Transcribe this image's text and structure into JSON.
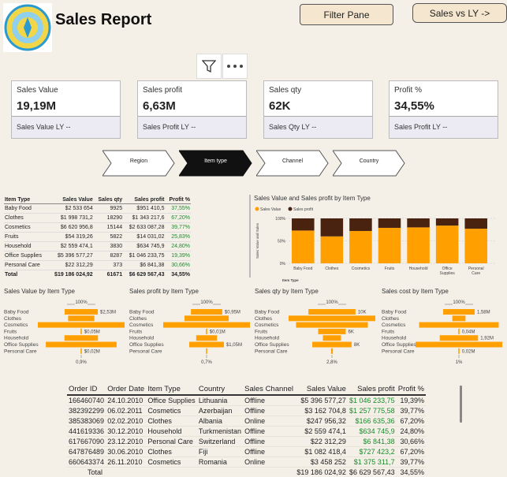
{
  "header": {
    "title": "Sales Report",
    "filter_pane_label": "Filter Pane",
    "sales_vs_ly_label": "Sales vs LY ->"
  },
  "kpis": [
    {
      "label": "Sales Value",
      "value": "19,19M",
      "ly": "Sales Value LY --"
    },
    {
      "label": "Sales profit",
      "value": "6,63M",
      "ly": "Sales Profit LY --"
    },
    {
      "label": "Sales qty",
      "value": "62K",
      "ly": "Sales Qty LY --"
    },
    {
      "label": "Profit %",
      "value": "34,55%",
      "ly": "Sales Profit LY --"
    }
  ],
  "nav": [
    "Region",
    "Item type",
    "Channel",
    "Country"
  ],
  "nav_active": 1,
  "item_table": {
    "headers": [
      "Item Type",
      "Sales Value",
      "Sales qty",
      "Sales profit",
      "Profit %"
    ],
    "rows": [
      [
        "Baby Food",
        "$2 533 654",
        "9925",
        "$951 410,5",
        "37,55%"
      ],
      [
        "Clothes",
        "$1 998 731,2",
        "18290",
        "$1 343 217,6",
        "67,20%"
      ],
      [
        "Cosmetics",
        "$6 620 956,8",
        "15144",
        "$2 633 087,28",
        "39,77%"
      ],
      [
        "Fruits",
        "$54 319,26",
        "5822",
        "$14 031,02",
        "25,83%"
      ],
      [
        "Household",
        "$2 559 474,1",
        "3830",
        "$634 745,9",
        "24,80%"
      ],
      [
        "Office Supplies",
        "$5 396 577,27",
        "8287",
        "$1 046 233,75",
        "19,39%"
      ],
      [
        "Personal Care",
        "$22 312,29",
        "373",
        "$6 841,38",
        "30,66%"
      ]
    ],
    "total": [
      "Total",
      "$19 186 024,92",
      "61671",
      "$6 629 567,43",
      "34,55%"
    ]
  },
  "stacked_chart": {
    "title": "Sales Value and Sales profit by Item Type",
    "legend": [
      "Sales Value",
      "Sales profit"
    ],
    "colors": [
      "#ff9f00",
      "#4a2210"
    ],
    "ylabel": "Sales Value and Sales",
    "xlabel": "Item Type",
    "yticks": [
      "100%",
      "50%",
      "0%"
    ]
  },
  "chart_data": [
    {
      "type": "bar",
      "title": "Sales Value and Sales profit by Item Type",
      "categories": [
        "Baby Food",
        "Clothes",
        "Cosmetics",
        "Fruits",
        "Household",
        "Office Supplies",
        "Personal Care"
      ],
      "series": [
        {
          "name": "Sales Value",
          "values": [
            73,
            60,
            72,
            79,
            80,
            84,
            77
          ]
        },
        {
          "name": "Sales profit",
          "values": [
            27,
            40,
            28,
            21,
            20,
            16,
            23
          ]
        }
      ],
      "xlabel": "Item Type",
      "ylabel": "Sales Value and Sales",
      "ylim": [
        0,
        100
      ]
    },
    {
      "type": "bar",
      "title": "Sales Value by Item Type",
      "categories": [
        "Baby Food",
        "Clothes",
        "Cosmetics",
        "Fruits",
        "Household",
        "Office Supplies",
        "Personal Care"
      ],
      "values": [
        2.53,
        2.0,
        6.62,
        0.05,
        2.56,
        5.4,
        0.02
      ],
      "top_label": "100%",
      "bottom_label": "0,9%",
      "bar_labels": [
        "$2,53M",
        "",
        "",
        "$0,05M",
        "",
        "",
        "$0,02M"
      ]
    },
    {
      "type": "bar",
      "title": "Sales profit by Item Type",
      "categories": [
        "Baby Food",
        "Clothes",
        "Cosmetics",
        "Fruits",
        "Household",
        "Office Supplies",
        "Personal Care"
      ],
      "values": [
        0.95,
        1.34,
        2.63,
        0.01,
        0.63,
        1.05,
        0.01
      ],
      "top_label": "100%",
      "bottom_label": "0,7%",
      "bar_labels": [
        "$0,95M",
        "",
        "",
        "$0,01M",
        "",
        "$1,05M",
        ""
      ]
    },
    {
      "type": "bar",
      "title": "Sales qty by Item Type",
      "categories": [
        "Baby Food",
        "Clothes",
        "Cosmetics",
        "Fruits",
        "Household",
        "Office Supplies",
        "Personal Care"
      ],
      "values": [
        9925,
        18290,
        15144,
        5822,
        3830,
        8287,
        373
      ],
      "top_label": "100%",
      "bottom_label": "2,8%",
      "bar_labels": [
        "10K",
        "",
        "",
        "6K",
        "",
        "8K",
        ""
      ]
    },
    {
      "type": "bar",
      "title": "Sales cost by Item Type",
      "categories": [
        "Baby Food",
        "Clothes",
        "Cosmetics",
        "Fruits",
        "Household",
        "Office Supplies",
        "Personal Care"
      ],
      "values": [
        1.58,
        0.66,
        3.99,
        0.04,
        1.92,
        4.35,
        0.02
      ],
      "top_label": "100%",
      "bottom_label": "1%",
      "bar_labels": [
        "1,58M",
        "",
        "",
        "0,04M",
        "1,92M",
        "",
        "0,02M"
      ]
    }
  ],
  "orders_table": {
    "headers": [
      "Order ID",
      "Order Date",
      "Item Type",
      "Country",
      "Sales Channel",
      "Sales Value",
      "Sales profit",
      "Profit %"
    ],
    "rows": [
      [
        "166460740",
        "24.10.2010",
        "Office Supplies",
        "Lithuania",
        "Offline",
        "$5 396 577,27",
        "$1 046 233,75",
        "19,39%"
      ],
      [
        "382392299",
        "06.02.2011",
        "Cosmetics",
        "Azerbaijan",
        "Offline",
        "$3 162 704,8",
        "$1 257 775,58",
        "39,77%"
      ],
      [
        "385383069",
        "02.02.2010",
        "Clothes",
        "Albania",
        "Online",
        "$247 956,32",
        "$166 635,36",
        "67,20%"
      ],
      [
        "441619336",
        "30.12.2010",
        "Household",
        "Turkmenistan",
        "Offline",
        "$2 559 474,1",
        "$634 745,9",
        "24,80%"
      ],
      [
        "617667090",
        "23.12.2010",
        "Personal Care",
        "Switzerland",
        "Offline",
        "$22 312,29",
        "$6 841,38",
        "30,66%"
      ],
      [
        "647876489",
        "30.06.2010",
        "Clothes",
        "Fiji",
        "Offline",
        "$1 082 418,4",
        "$727 423,2",
        "67,20%"
      ],
      [
        "660643374",
        "26.11.2010",
        "Cosmetics",
        "Romania",
        "Online",
        "$3 458 252",
        "$1 375 311,7",
        "39,77%"
      ]
    ],
    "total": [
      "Total",
      "",
      "",
      "",
      "",
      "$19 186 024,92",
      "$6 629 567,43",
      "34,55%"
    ]
  }
}
